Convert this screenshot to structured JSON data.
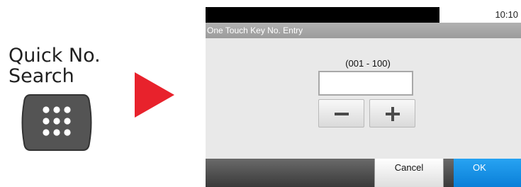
{
  "key_caption": {
    "line1": "Quick No.",
    "line2": "Search"
  },
  "status_bar": {
    "time": "10:10"
  },
  "title_bar": {
    "title": "One Touch Key No. Entry"
  },
  "entry": {
    "range_label": "(001 - 100)",
    "value": ""
  },
  "footer": {
    "cancel_label": "Cancel",
    "ok_label": "OK"
  },
  "colors": {
    "arrow": "#e8222c",
    "ok_button": "#1a90e6",
    "hardware_key": "#545454"
  },
  "icons": {
    "hardware_key": "keypad-icon",
    "arrow": "arrow-right-icon",
    "minus": "minus-icon",
    "plus": "plus-icon"
  }
}
